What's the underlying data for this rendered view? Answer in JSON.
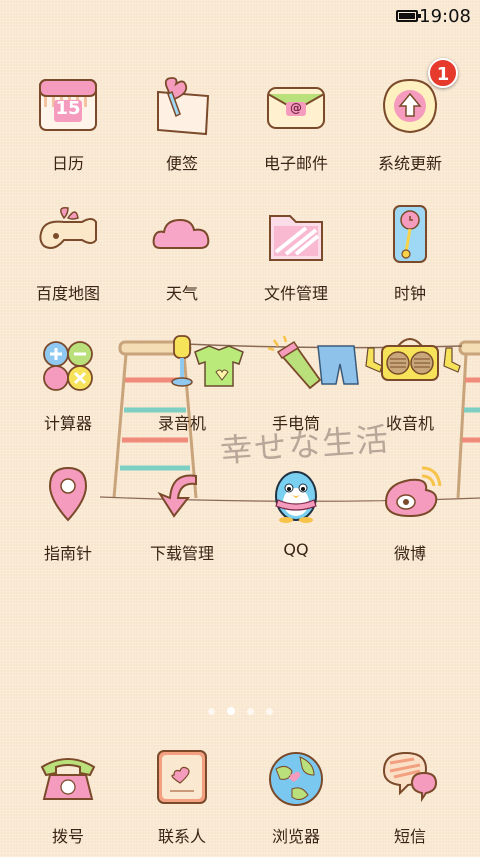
{
  "status_bar": {
    "time": "19:08"
  },
  "apps": [
    {
      "label": "日历",
      "icon": "calendar-icon",
      "number": "15"
    },
    {
      "label": "便签",
      "icon": "notes-icon"
    },
    {
      "label": "电子邮件",
      "icon": "email-icon",
      "glyph": "@"
    },
    {
      "label": "系统更新",
      "icon": "system-update-icon",
      "badge": "1"
    },
    {
      "label": "百度地图",
      "icon": "map-icon"
    },
    {
      "label": "天气",
      "icon": "weather-cloud-icon"
    },
    {
      "label": "文件管理",
      "icon": "folder-icon"
    },
    {
      "label": "时钟",
      "icon": "clock-icon"
    },
    {
      "label": "计算器",
      "icon": "calculator-icon"
    },
    {
      "label": "录音机",
      "icon": "recorder-icon"
    },
    {
      "label": "手电筒",
      "icon": "flashlight-icon"
    },
    {
      "label": "收音机",
      "icon": "radio-icon"
    },
    {
      "label": "指南针",
      "icon": "compass-pin-icon"
    },
    {
      "label": "下载管理",
      "icon": "download-arrow-icon"
    },
    {
      "label": "QQ",
      "icon": "qq-penguin-icon"
    },
    {
      "label": "微博",
      "icon": "weibo-icon"
    }
  ],
  "wallpaper": {
    "tagline": "幸せな生活"
  },
  "pager": {
    "pages": 4,
    "current": 2
  },
  "dock": [
    {
      "label": "拨号",
      "icon": "phone-icon"
    },
    {
      "label": "联系人",
      "icon": "contacts-icon"
    },
    {
      "label": "浏览器",
      "icon": "browser-globe-icon"
    },
    {
      "label": "短信",
      "icon": "messages-icon"
    }
  ],
  "colors": {
    "background": "#f8e6cf",
    "label": "#3a2515",
    "badge": "#e53a2c"
  }
}
